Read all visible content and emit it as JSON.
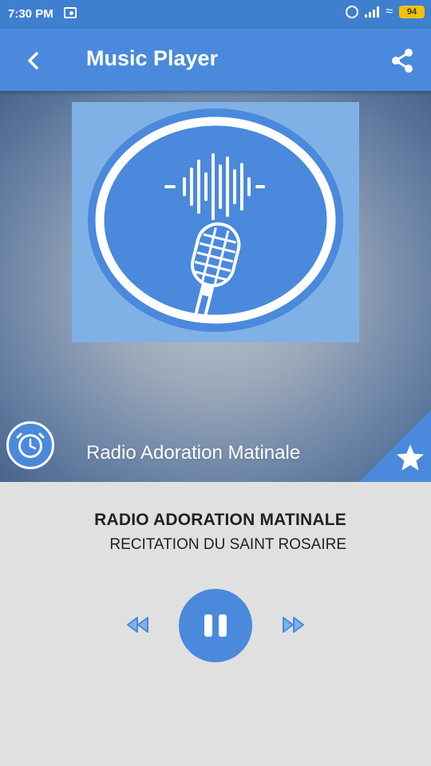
{
  "status_bar": {
    "time": "7:30 PM",
    "battery": "94",
    "icons": [
      "radio-icon",
      "alarm-icon",
      "signal-icon",
      "wifi-icon",
      "battery-icon"
    ]
  },
  "app_bar": {
    "title": "Music Player",
    "back_icon": "chevron-left-icon",
    "share_icon": "share-icon"
  },
  "hero": {
    "artwork_icon": "microphone-soundwave-icon",
    "station_name": "Radio Adoration Matinale",
    "timer_icon": "clock-icon",
    "favorite_icon": "star-icon"
  },
  "now_playing": {
    "title": "RADIO ADORATION MATINALE",
    "subtitle": "RECITATION DU SAINT ROSAIRE"
  },
  "controls": {
    "rewind_icon": "rewind-icon",
    "play_pause_icon": "pause-icon",
    "forward_icon": "fast-forward-icon"
  },
  "colors": {
    "primary": "#4a89dc",
    "status_bar": "#3f7fd0",
    "artwork_bg": "#7fb1e6",
    "background": "#e0e0e0",
    "battery": "#f2c200"
  }
}
